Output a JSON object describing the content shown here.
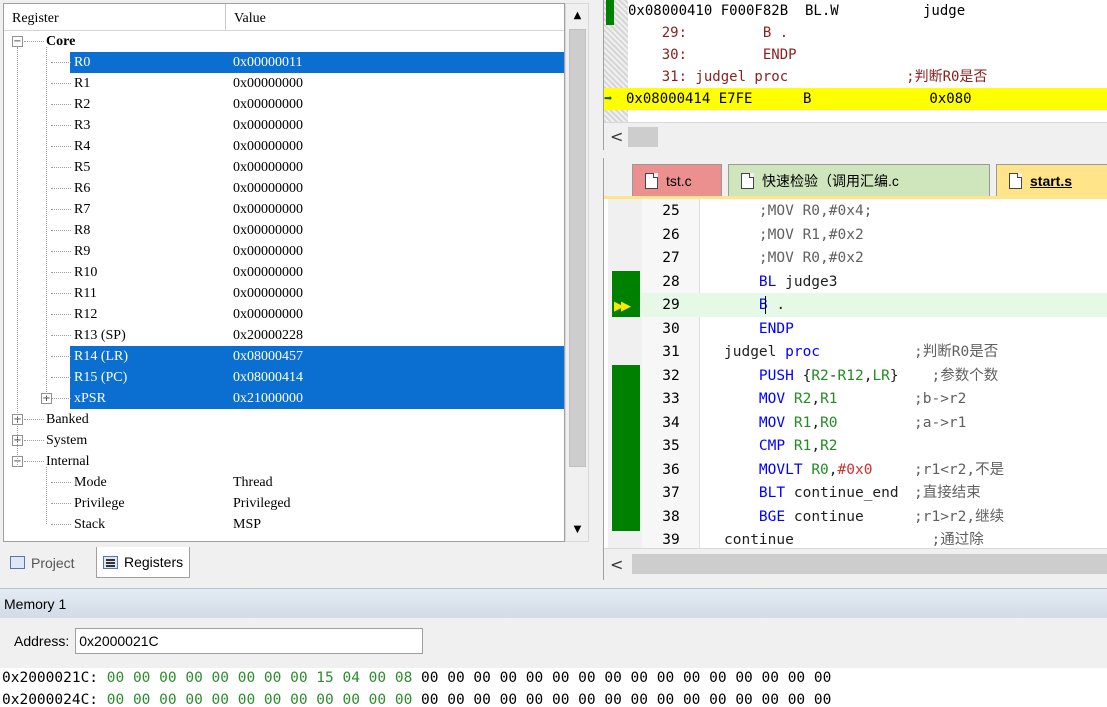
{
  "registers_panel": {
    "columns": {
      "register": "Register",
      "value": "Value"
    },
    "rows": [
      {
        "name": "Core",
        "value": "",
        "level": 0,
        "toggle": "minus",
        "bold": true
      },
      {
        "name": "R0",
        "value": "0x00000011",
        "level": 1,
        "selected": true
      },
      {
        "name": "R1",
        "value": "0x00000000",
        "level": 1
      },
      {
        "name": "R2",
        "value": "0x00000000",
        "level": 1
      },
      {
        "name": "R3",
        "value": "0x00000000",
        "level": 1
      },
      {
        "name": "R4",
        "value": "0x00000000",
        "level": 1
      },
      {
        "name": "R5",
        "value": "0x00000000",
        "level": 1
      },
      {
        "name": "R6",
        "value": "0x00000000",
        "level": 1
      },
      {
        "name": "R7",
        "value": "0x00000000",
        "level": 1
      },
      {
        "name": "R8",
        "value": "0x00000000",
        "level": 1
      },
      {
        "name": "R9",
        "value": "0x00000000",
        "level": 1
      },
      {
        "name": "R10",
        "value": "0x00000000",
        "level": 1
      },
      {
        "name": "R11",
        "value": "0x00000000",
        "level": 1
      },
      {
        "name": "R12",
        "value": "0x00000000",
        "level": 1
      },
      {
        "name": "R13 (SP)",
        "value": "0x20000228",
        "level": 1
      },
      {
        "name": "R14 (LR)",
        "value": "0x08000457",
        "level": 1,
        "selected": true
      },
      {
        "name": "R15 (PC)",
        "value": "0x08000414",
        "level": 1,
        "selected": true
      },
      {
        "name": "xPSR",
        "value": "0x21000000",
        "level": 1,
        "selected": true,
        "toggle": "plus"
      },
      {
        "name": "Banked",
        "value": "",
        "level": 0,
        "toggle": "plus"
      },
      {
        "name": "System",
        "value": "",
        "level": 0,
        "toggle": "plus"
      },
      {
        "name": "Internal",
        "value": "",
        "level": 0,
        "toggle": "minus"
      },
      {
        "name": "Mode",
        "value": "Thread",
        "level": 1
      },
      {
        "name": "Privilege",
        "value": "Privileged",
        "level": 1
      },
      {
        "name": "Stack",
        "value": "MSP",
        "level": 1
      }
    ],
    "tabs": [
      {
        "label": "Project",
        "icon": "project-icon",
        "active": false
      },
      {
        "label": "Registers",
        "icon": "registers-icon",
        "active": true
      }
    ]
  },
  "disassembly": {
    "lines": [
      {
        "text": "0x08000410 F000F82B  BL.W          judge",
        "kind": "asm"
      },
      {
        "text": "    29:         B .",
        "kind": "src"
      },
      {
        "text": "    30:         ENDP",
        "kind": "src"
      },
      {
        "text": "    31: judgel proc              ;判断R0是否",
        "kind": "src"
      },
      {
        "text": "0x08000414 E7FE      B              0x080",
        "kind": "current"
      }
    ],
    "current_arrow": "➡"
  },
  "editor": {
    "tabs": [
      {
        "label": "tst.c",
        "color": "pink"
      },
      {
        "label": "快速检验（调用汇编.c",
        "color": "green"
      },
      {
        "label": "start.s",
        "color": "yellow",
        "active": true
      }
    ],
    "lines": [
      {
        "num": "25",
        "code": "    ;MOV R0,#0x4;",
        "comment": "",
        "kind": "cmt"
      },
      {
        "num": "26",
        "code": "    ;MOV R1,#0x2",
        "comment": "",
        "kind": "cmt"
      },
      {
        "num": "27",
        "code": "    ;MOV R0,#0x2",
        "comment": "",
        "kind": "cmt"
      },
      {
        "num": "28",
        "code": "    BL judge3",
        "comment": "",
        "kind": "code"
      },
      {
        "num": "29",
        "code": "    B .",
        "comment": "",
        "kind": "current"
      },
      {
        "num": "30",
        "code": "    ENDP",
        "comment": "",
        "kind": "code"
      },
      {
        "num": "31",
        "code": "judgel proc",
        "comment": ";判断R0是否",
        "kind": "code"
      },
      {
        "num": "32",
        "code": "    PUSH {R2-R12,LR}",
        "comment": "  ;参数个数",
        "kind": "code"
      },
      {
        "num": "33",
        "code": "    MOV R2,R1",
        "comment": ";b->r2",
        "kind": "code"
      },
      {
        "num": "34",
        "code": "    MOV R1,R0",
        "comment": ";a->r1",
        "kind": "code"
      },
      {
        "num": "35",
        "code": "    CMP R1,R2",
        "comment": "",
        "kind": "code"
      },
      {
        "num": "36",
        "code": "    MOVLT R0,#0x0",
        "comment": ";r1<r2,不是",
        "kind": "code"
      },
      {
        "num": "37",
        "code": "    BLT continue_end",
        "comment": ";直接结束",
        "kind": "code"
      },
      {
        "num": "38",
        "code": "    BGE continue",
        "comment": ";r1>r2,继续",
        "kind": "code"
      },
      {
        "num": "39",
        "code": "continue",
        "comment": "  ;通过除",
        "kind": "code"
      }
    ],
    "exec_marker": "▶▶"
  },
  "memory": {
    "title": "Memory 1",
    "address_label": "Address:",
    "address_value": "0x2000021C",
    "rows": [
      {
        "addr": "0x2000021C:",
        "bytes": [
          "00",
          "00",
          "00",
          "00",
          "00",
          "00",
          "00",
          "00",
          "15",
          "04",
          "00",
          "08"
        ],
        "rest": [
          "00",
          "00",
          "00",
          "00",
          "00",
          "00",
          "00",
          "00",
          "00",
          "00",
          "00",
          "00",
          "00",
          "00",
          "00",
          "00"
        ]
      },
      {
        "addr": "0x2000024C:",
        "bytes": [
          "00",
          "00",
          "00",
          "00",
          "00",
          "00",
          "00",
          "00",
          "00",
          "00",
          "00",
          "00"
        ],
        "rest": [
          "00",
          "00",
          "00",
          "00",
          "00",
          "00",
          "00",
          "00",
          "00",
          "00",
          "00",
          "00",
          "00",
          "00",
          "00",
          "00"
        ]
      }
    ]
  },
  "colors": {
    "selection": "#0a6fd0",
    "current_line": "#ffff00",
    "breakpoint_bar": "#008000",
    "keyword": "#0000ff",
    "register": "#228b22",
    "immediate": "#d03030"
  }
}
